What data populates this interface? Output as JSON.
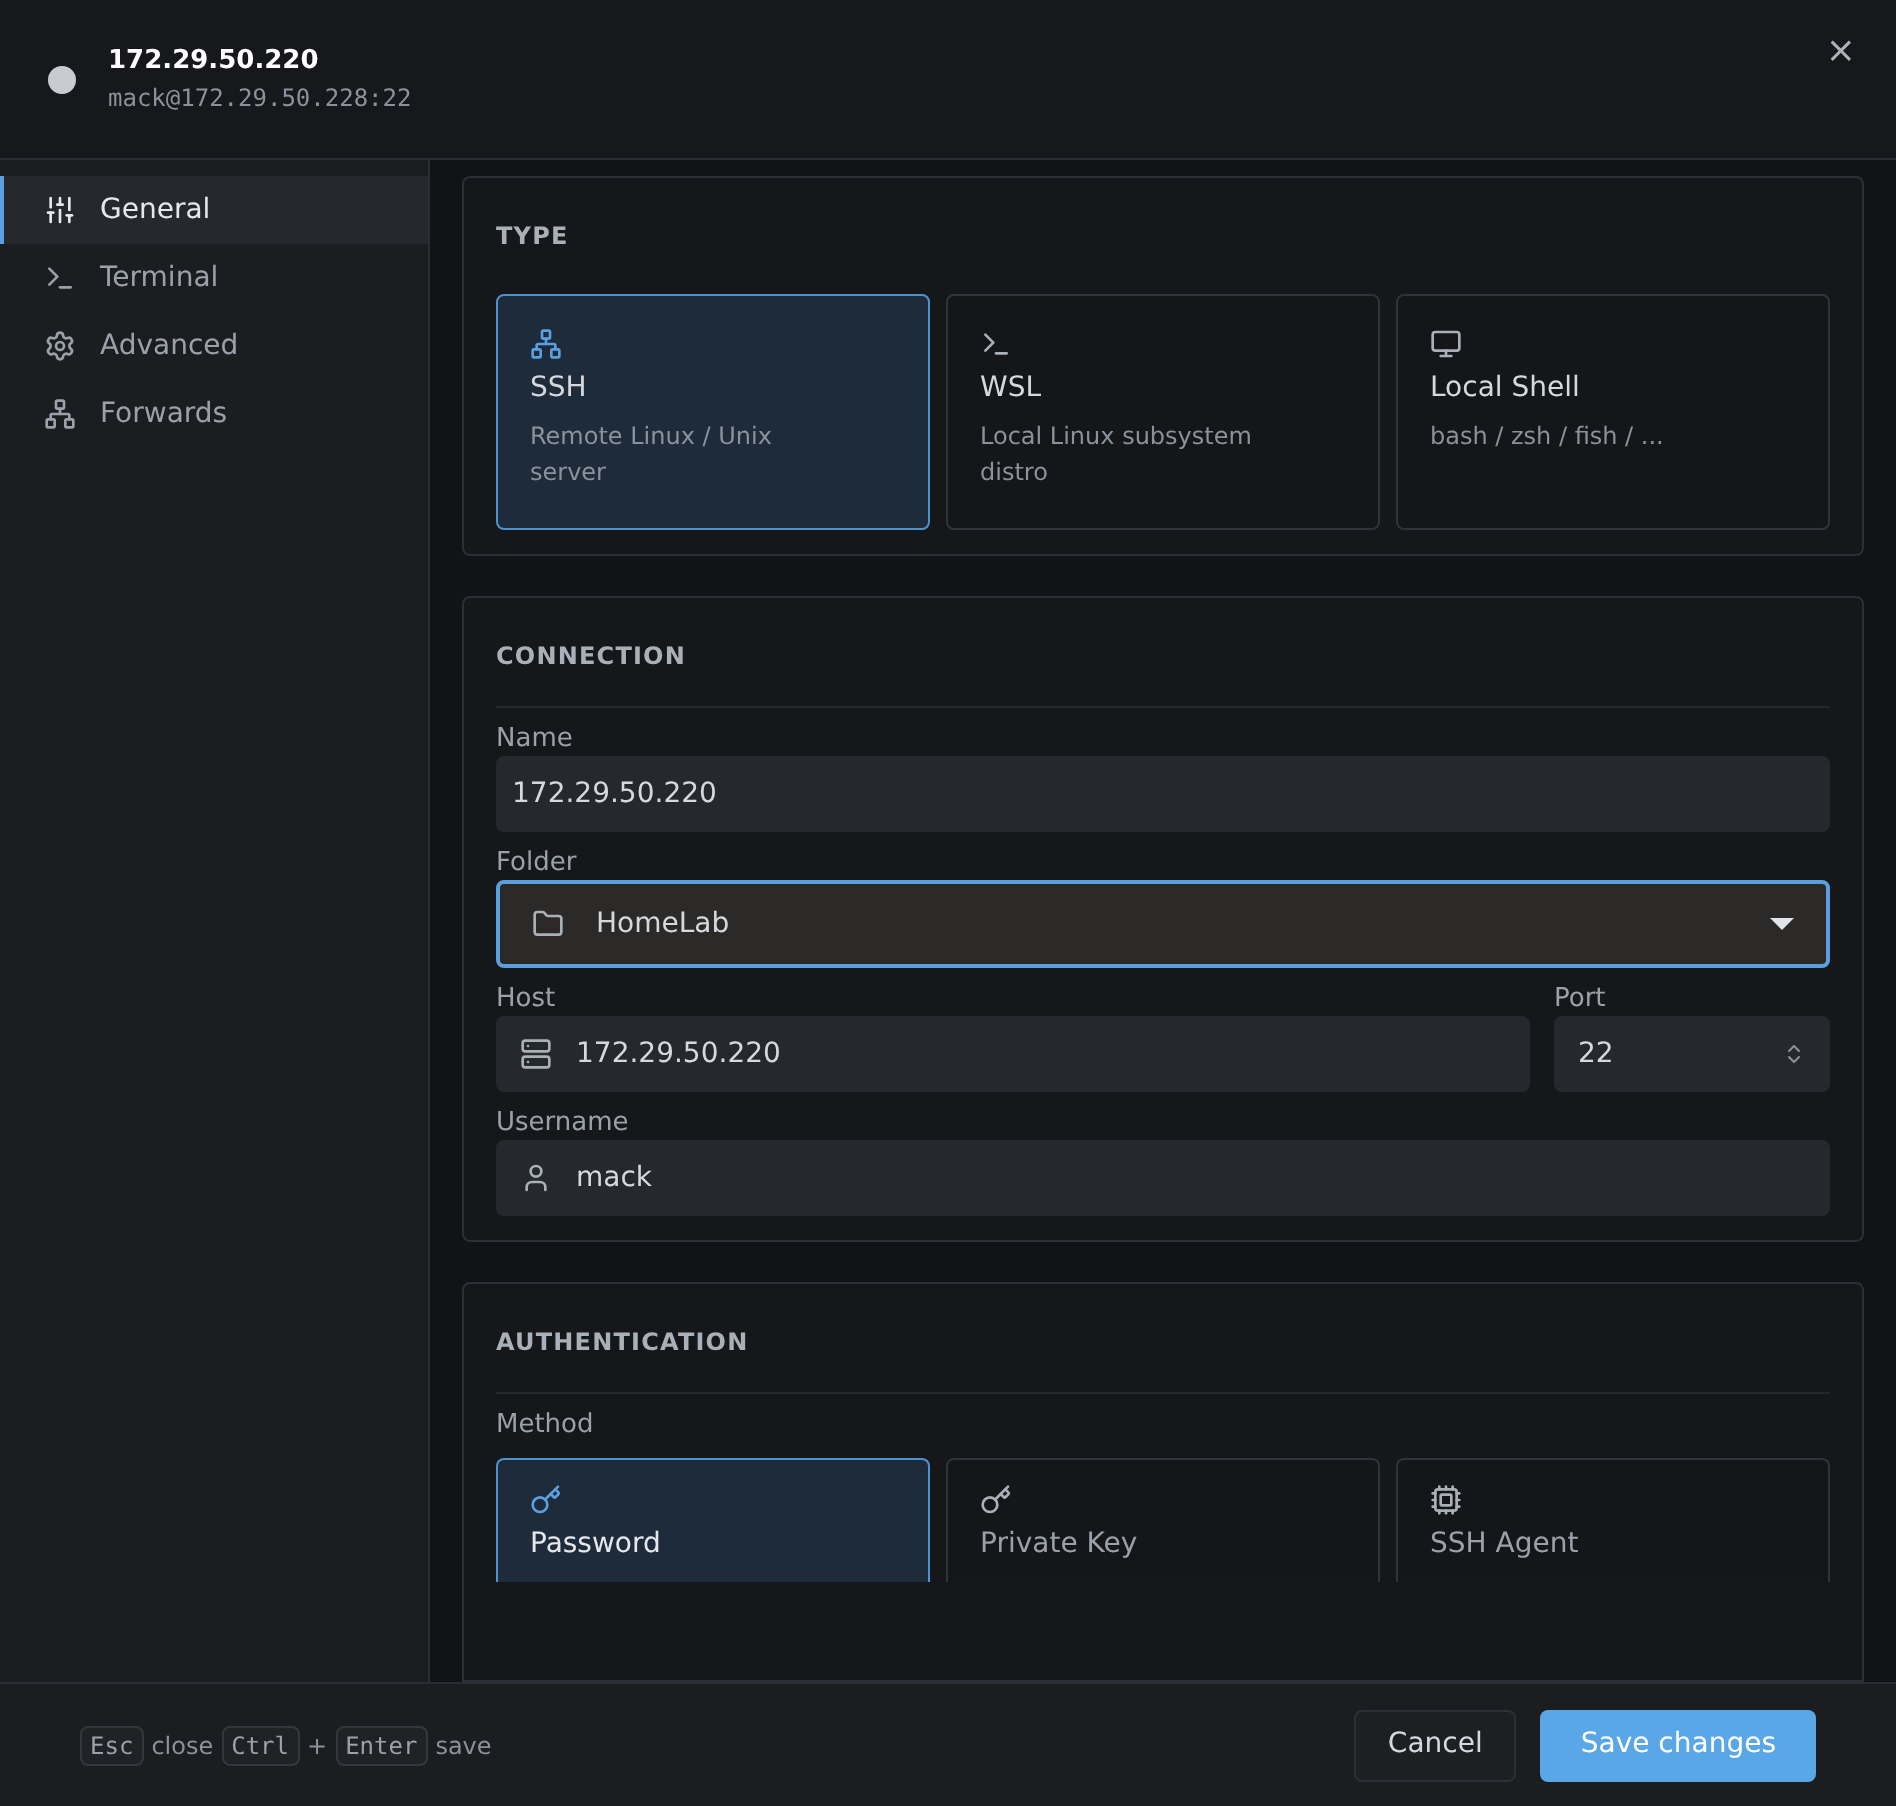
{
  "header": {
    "title": "172.29.50.220",
    "subtitle": "mack@172.29.50.228:22",
    "close": "×"
  },
  "sidebar": {
    "items": [
      {
        "label": "General",
        "selected": true
      },
      {
        "label": "Terminal",
        "selected": false
      },
      {
        "label": "Advanced",
        "selected": false
      },
      {
        "label": "Forwards",
        "selected": false
      }
    ]
  },
  "type_section": {
    "heading": "TYPE",
    "options": [
      {
        "title": "SSH",
        "description": "Remote Linux / Unix server",
        "selected": true
      },
      {
        "title": "WSL",
        "description": "Local Linux subsystem distro",
        "selected": false
      },
      {
        "title": "Local Shell",
        "description": "bash / zsh / fish / ...",
        "selected": false
      }
    ]
  },
  "connection": {
    "heading": "CONNECTION",
    "name": {
      "label": "Name",
      "value": "172.29.50.220"
    },
    "folder": {
      "label": "Folder",
      "value": "HomeLab",
      "focused": true
    },
    "host": {
      "label": "Host",
      "value": "172.29.50.220"
    },
    "port": {
      "label": "Port",
      "value": "22"
    },
    "username": {
      "label": "Username",
      "value": "mack"
    }
  },
  "authentication": {
    "heading": "AUTHENTICATION",
    "method_label": "Method",
    "methods": [
      {
        "label": "Password",
        "selected": true
      },
      {
        "label": "Private Key",
        "selected": false
      },
      {
        "label": "SSH Agent",
        "selected": false
      }
    ]
  },
  "footer": {
    "hints": [
      {
        "kind": "key",
        "text": "Esc"
      },
      {
        "kind": "text",
        "text": "close"
      },
      {
        "kind": "key",
        "text": "Ctrl"
      },
      {
        "kind": "text",
        "text": "+"
      },
      {
        "kind": "key",
        "text": "Enter"
      },
      {
        "kind": "text",
        "text": "save"
      }
    ],
    "cancel": "Cancel",
    "save": "Save changes"
  }
}
